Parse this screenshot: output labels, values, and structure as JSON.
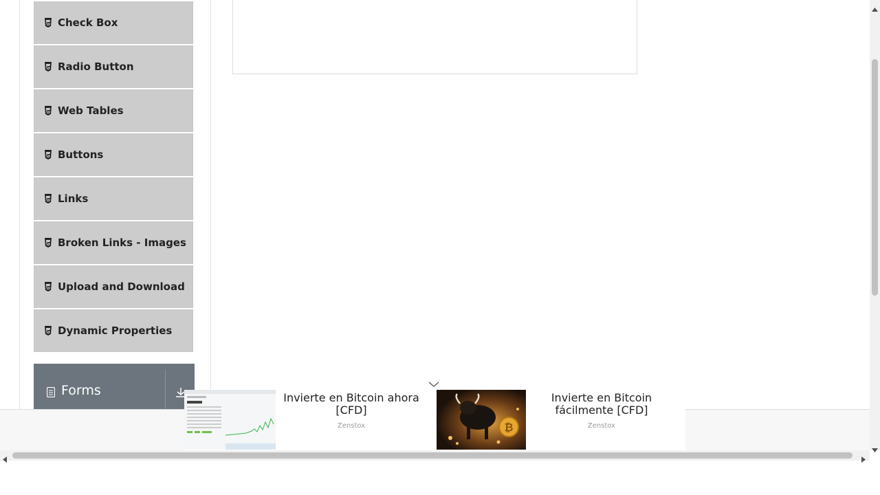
{
  "sidebar": {
    "elements_items": [
      {
        "label": "Check Box",
        "icon": "html5-icon"
      },
      {
        "label": "Radio Button",
        "icon": "html5-icon"
      },
      {
        "label": "Web Tables",
        "icon": "html5-icon"
      },
      {
        "label": "Buttons",
        "icon": "html5-icon"
      },
      {
        "label": "Links",
        "icon": "html5-icon"
      },
      {
        "label": "Broken Links - Images",
        "icon": "html5-icon"
      },
      {
        "label": "Upload and Download",
        "icon": "html5-icon"
      },
      {
        "label": "Dynamic Properties",
        "icon": "html5-icon"
      }
    ],
    "forms_group": {
      "label": "Forms",
      "icon": "document-icon",
      "toggle_icon": "download-arrow-icon"
    }
  },
  "ad": {
    "items": [
      {
        "title": "Invierte en Bitcoin ahora [CFD]",
        "source": "Zenstox",
        "image": "trading-chart-screenshot"
      },
      {
        "title": "Invierte en Bitcoin fácilmente [CFD]",
        "source": "Zenstox",
        "image": "bull-bitcoin-image"
      }
    ],
    "collapse_icon": "chevron-down-icon"
  },
  "colors": {
    "menu_item_bg": "#cccccc",
    "forms_header_bg": "#6c757d",
    "scroll_thumb": "#c1c1c1"
  }
}
